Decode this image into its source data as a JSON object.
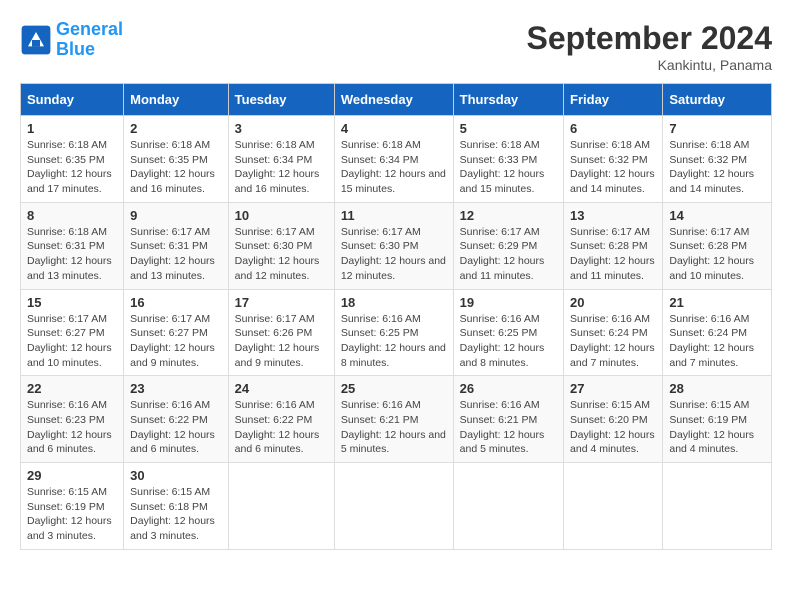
{
  "header": {
    "logo_line1": "General",
    "logo_line2": "Blue",
    "month_title": "September 2024",
    "location": "Kankintu, Panama"
  },
  "weekdays": [
    "Sunday",
    "Monday",
    "Tuesday",
    "Wednesday",
    "Thursday",
    "Friday",
    "Saturday"
  ],
  "weeks": [
    [
      {
        "day": "1",
        "sunrise": "6:18 AM",
        "sunset": "6:35 PM",
        "daylight": "12 hours and 17 minutes."
      },
      {
        "day": "2",
        "sunrise": "6:18 AM",
        "sunset": "6:35 PM",
        "daylight": "12 hours and 16 minutes."
      },
      {
        "day": "3",
        "sunrise": "6:18 AM",
        "sunset": "6:34 PM",
        "daylight": "12 hours and 16 minutes."
      },
      {
        "day": "4",
        "sunrise": "6:18 AM",
        "sunset": "6:34 PM",
        "daylight": "12 hours and 15 minutes."
      },
      {
        "day": "5",
        "sunrise": "6:18 AM",
        "sunset": "6:33 PM",
        "daylight": "12 hours and 15 minutes."
      },
      {
        "day": "6",
        "sunrise": "6:18 AM",
        "sunset": "6:32 PM",
        "daylight": "12 hours and 14 minutes."
      },
      {
        "day": "7",
        "sunrise": "6:18 AM",
        "sunset": "6:32 PM",
        "daylight": "12 hours and 14 minutes."
      }
    ],
    [
      {
        "day": "8",
        "sunrise": "6:18 AM",
        "sunset": "6:31 PM",
        "daylight": "12 hours and 13 minutes."
      },
      {
        "day": "9",
        "sunrise": "6:17 AM",
        "sunset": "6:31 PM",
        "daylight": "12 hours and 13 minutes."
      },
      {
        "day": "10",
        "sunrise": "6:17 AM",
        "sunset": "6:30 PM",
        "daylight": "12 hours and 12 minutes."
      },
      {
        "day": "11",
        "sunrise": "6:17 AM",
        "sunset": "6:30 PM",
        "daylight": "12 hours and 12 minutes."
      },
      {
        "day": "12",
        "sunrise": "6:17 AM",
        "sunset": "6:29 PM",
        "daylight": "12 hours and 11 minutes."
      },
      {
        "day": "13",
        "sunrise": "6:17 AM",
        "sunset": "6:28 PM",
        "daylight": "12 hours and 11 minutes."
      },
      {
        "day": "14",
        "sunrise": "6:17 AM",
        "sunset": "6:28 PM",
        "daylight": "12 hours and 10 minutes."
      }
    ],
    [
      {
        "day": "15",
        "sunrise": "6:17 AM",
        "sunset": "6:27 PM",
        "daylight": "12 hours and 10 minutes."
      },
      {
        "day": "16",
        "sunrise": "6:17 AM",
        "sunset": "6:27 PM",
        "daylight": "12 hours and 9 minutes."
      },
      {
        "day": "17",
        "sunrise": "6:17 AM",
        "sunset": "6:26 PM",
        "daylight": "12 hours and 9 minutes."
      },
      {
        "day": "18",
        "sunrise": "6:16 AM",
        "sunset": "6:25 PM",
        "daylight": "12 hours and 8 minutes."
      },
      {
        "day": "19",
        "sunrise": "6:16 AM",
        "sunset": "6:25 PM",
        "daylight": "12 hours and 8 minutes."
      },
      {
        "day": "20",
        "sunrise": "6:16 AM",
        "sunset": "6:24 PM",
        "daylight": "12 hours and 7 minutes."
      },
      {
        "day": "21",
        "sunrise": "6:16 AM",
        "sunset": "6:24 PM",
        "daylight": "12 hours and 7 minutes."
      }
    ],
    [
      {
        "day": "22",
        "sunrise": "6:16 AM",
        "sunset": "6:23 PM",
        "daylight": "12 hours and 6 minutes."
      },
      {
        "day": "23",
        "sunrise": "6:16 AM",
        "sunset": "6:22 PM",
        "daylight": "12 hours and 6 minutes."
      },
      {
        "day": "24",
        "sunrise": "6:16 AM",
        "sunset": "6:22 PM",
        "daylight": "12 hours and 6 minutes."
      },
      {
        "day": "25",
        "sunrise": "6:16 AM",
        "sunset": "6:21 PM",
        "daylight": "12 hours and 5 minutes."
      },
      {
        "day": "26",
        "sunrise": "6:16 AM",
        "sunset": "6:21 PM",
        "daylight": "12 hours and 5 minutes."
      },
      {
        "day": "27",
        "sunrise": "6:15 AM",
        "sunset": "6:20 PM",
        "daylight": "12 hours and 4 minutes."
      },
      {
        "day": "28",
        "sunrise": "6:15 AM",
        "sunset": "6:19 PM",
        "daylight": "12 hours and 4 minutes."
      }
    ],
    [
      {
        "day": "29",
        "sunrise": "6:15 AM",
        "sunset": "6:19 PM",
        "daylight": "12 hours and 3 minutes."
      },
      {
        "day": "30",
        "sunrise": "6:15 AM",
        "sunset": "6:18 PM",
        "daylight": "12 hours and 3 minutes."
      },
      null,
      null,
      null,
      null,
      null
    ]
  ]
}
